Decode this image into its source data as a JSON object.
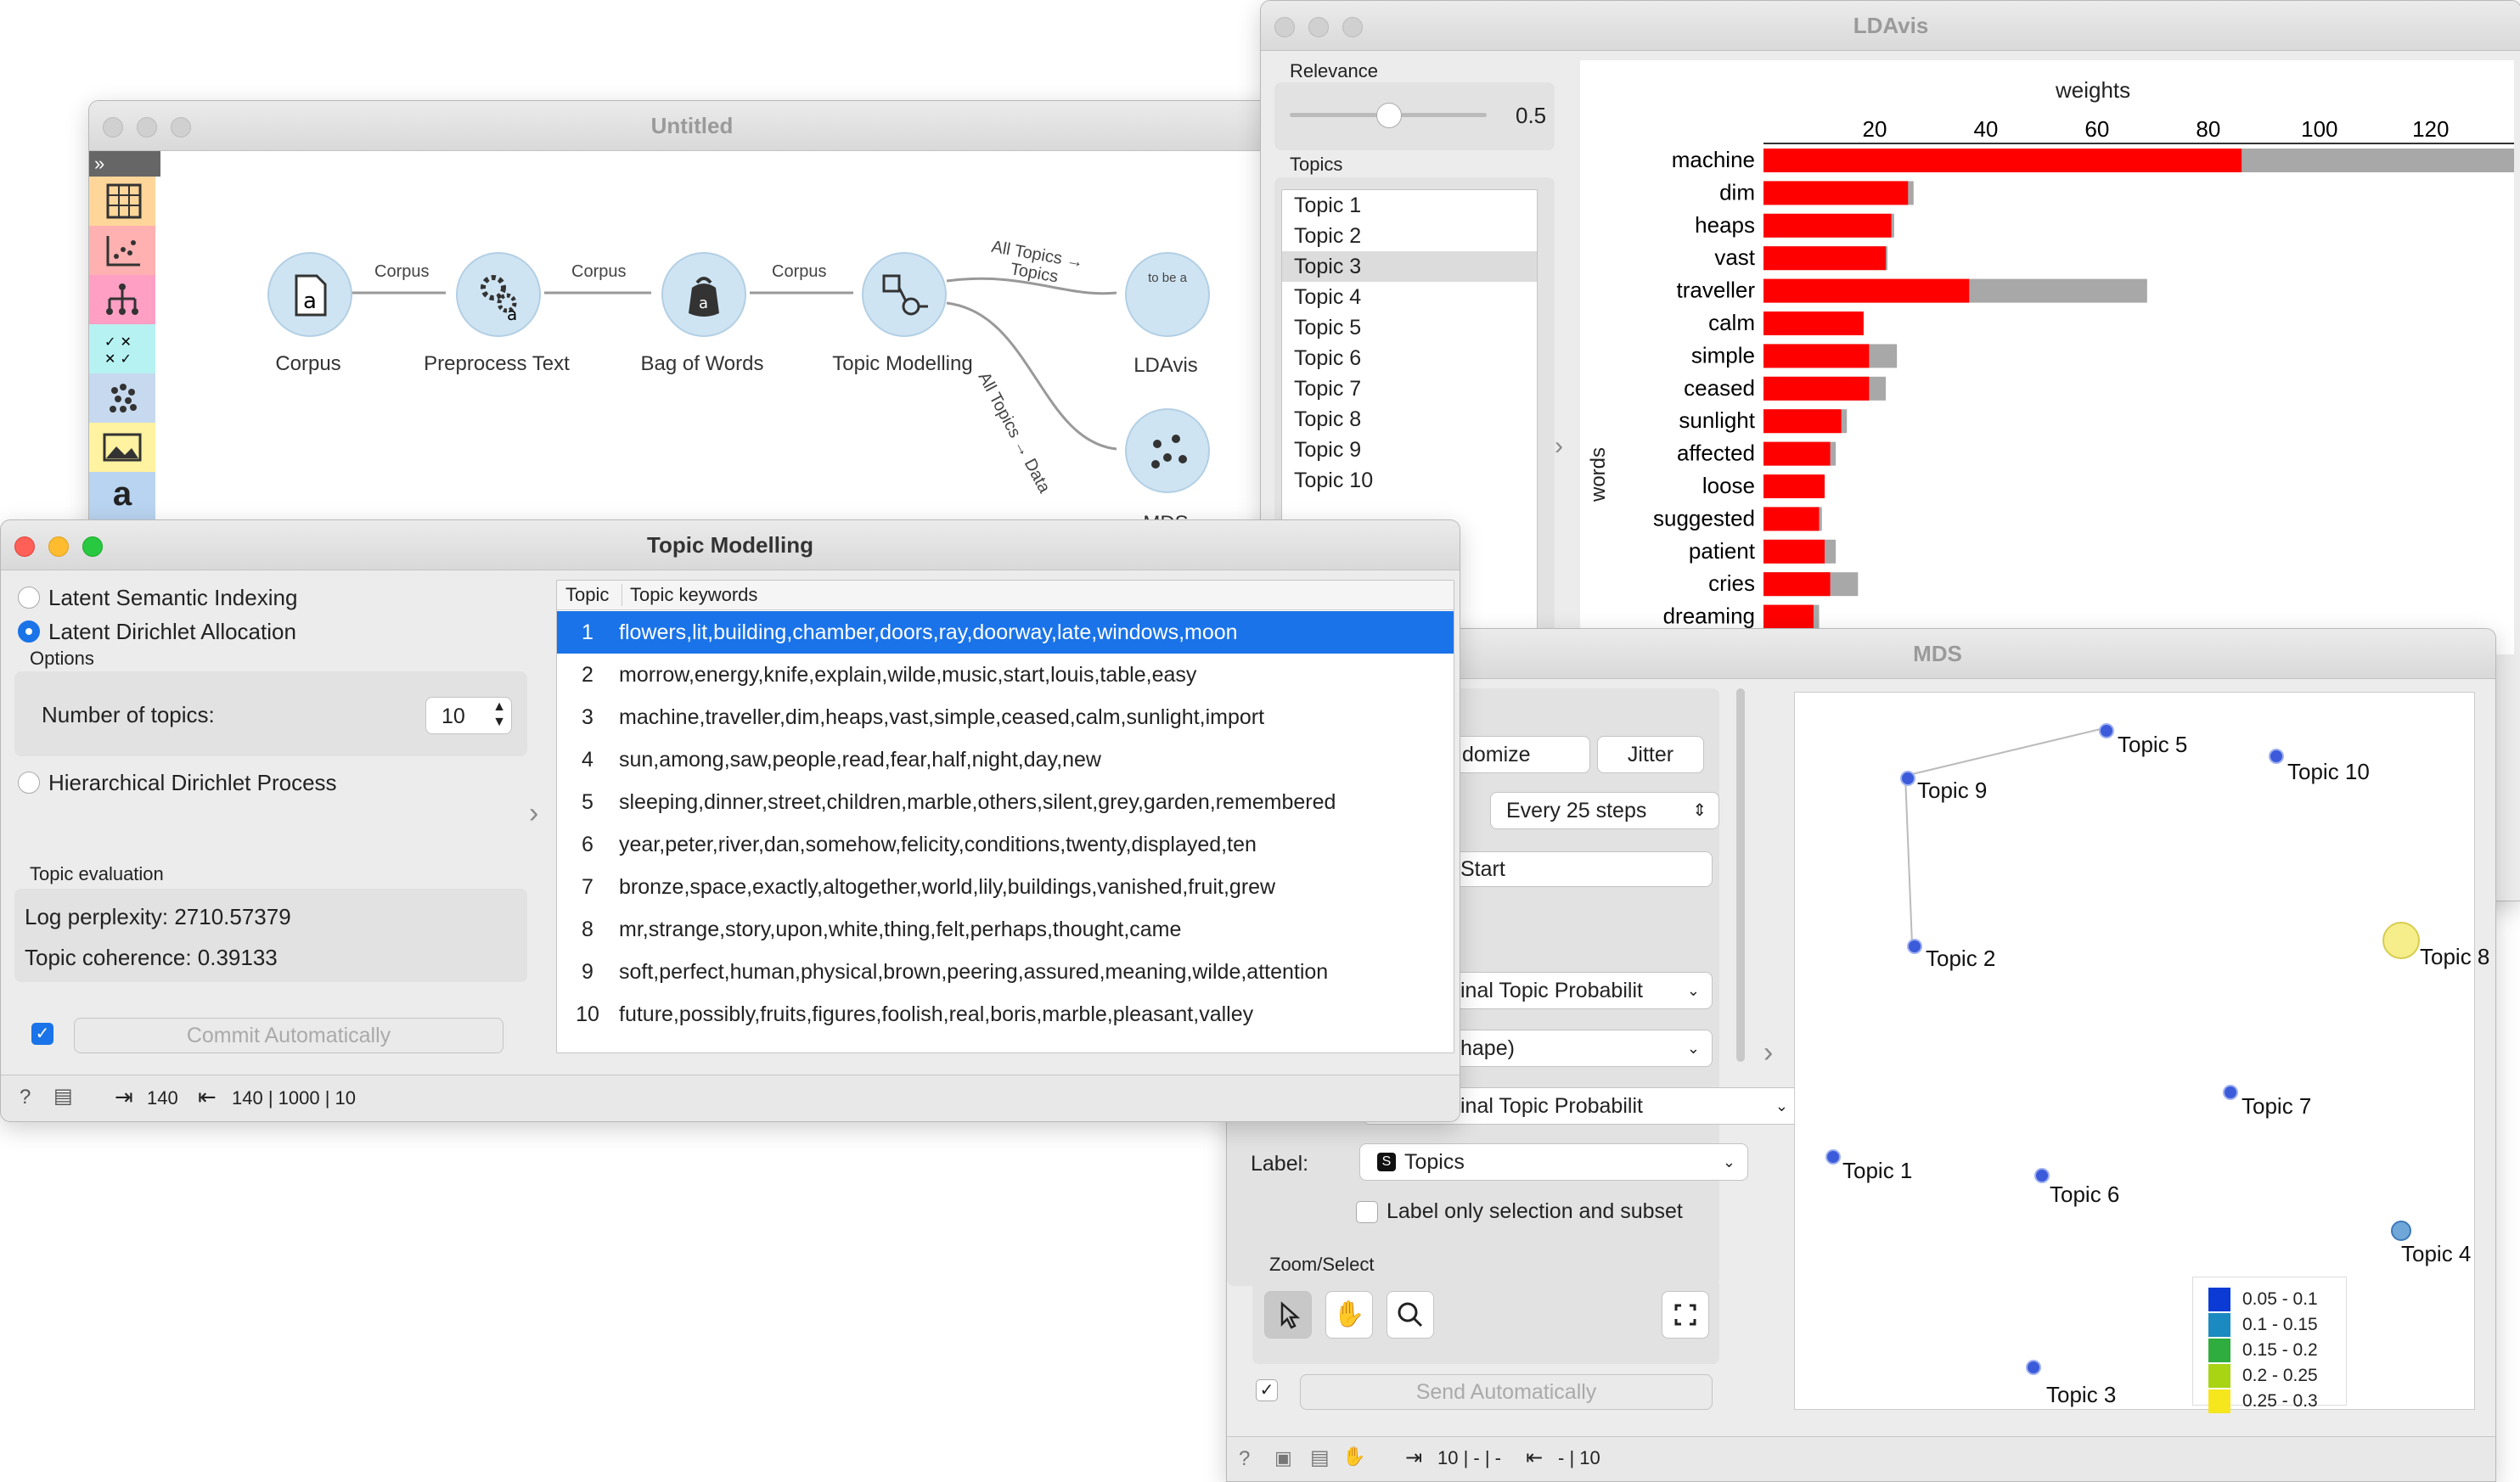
{
  "canvas_window": {
    "title": "Untitled",
    "nodes": [
      {
        "label": "Corpus"
      },
      {
        "label": "Preprocess Text"
      },
      {
        "label": "Bag of Words"
      },
      {
        "label": "Topic Modelling"
      },
      {
        "label": "LDAvis"
      },
      {
        "label": "MDS"
      }
    ],
    "links": [
      {
        "label": "Corpus"
      },
      {
        "label": "Corpus"
      },
      {
        "label": "Corpus"
      },
      {
        "label": "All Topics → Topics"
      },
      {
        "label": "All Topics → Data"
      }
    ],
    "ldavis_icon_text": "to be a",
    "toolbox_icons": [
      "data-table-icon",
      "scatter-icon",
      "tree-icon",
      "confusion-matrix-icon",
      "cluster-icon",
      "image-icon",
      "text-icon"
    ]
  },
  "topic_window": {
    "title": "Topic Modelling",
    "methods": [
      {
        "label": "Latent Semantic Indexing",
        "selected": false
      },
      {
        "label": "Latent Dirichlet Allocation",
        "selected": true
      },
      {
        "label": "Hierarchical Dirichlet Process",
        "selected": false
      }
    ],
    "options_label": "Options",
    "num_topics_label": "Number of topics:",
    "num_topics_value": "10",
    "evaluation_label": "Topic evaluation",
    "log_perplexity": "Log perplexity: 2710.57379",
    "coherence": "Topic coherence: 0.39133",
    "commit_label": "Commit Automatically",
    "table_headers": [
      "Topic",
      "Topic keywords"
    ],
    "rows": [
      {
        "num": "1",
        "keywords": "flowers,lit,building,chamber,doors,ray,doorway,late,windows,moon"
      },
      {
        "num": "2",
        "keywords": "morrow,energy,knife,explain,wilde,music,start,louis,table,easy"
      },
      {
        "num": "3",
        "keywords": "machine,traveller,dim,heaps,vast,simple,ceased,calm,sunlight,import"
      },
      {
        "num": "4",
        "keywords": "sun,among,saw,people,read,fear,half,night,day,new"
      },
      {
        "num": "5",
        "keywords": "sleeping,dinner,street,children,marble,others,silent,grey,garden,remembered"
      },
      {
        "num": "6",
        "keywords": "year,peter,river,dan,somehow,felicity,conditions,twenty,displayed,ten"
      },
      {
        "num": "7",
        "keywords": "bronze,space,exactly,altogether,world,lily,buildings,vanished,fruit,grew"
      },
      {
        "num": "8",
        "keywords": "mr,strange,story,upon,white,thing,felt,perhaps,thought,came"
      },
      {
        "num": "9",
        "keywords": "soft,perfect,human,physical,brown,peering,assured,meaning,wilde,attention"
      },
      {
        "num": "10",
        "keywords": "future,possibly,fruits,figures,foolish,real,boris,marble,pleasant,valley"
      }
    ],
    "status_in": "140",
    "status_out": "140 | 1000 | 10"
  },
  "ldavis_window": {
    "title": "LDAvis",
    "relevance_label": "Relevance",
    "relevance_value": "0.5",
    "relevance_fraction": 0.5,
    "topics_label": "Topics",
    "topics": [
      "Topic 1",
      "Topic 2",
      "Topic 3",
      "Topic 4",
      "Topic 5",
      "Topic 6",
      "Topic 7",
      "Topic 8",
      "Topic 9",
      "Topic 10"
    ],
    "selected_topic_index": 2
  },
  "chart_data": {
    "type": "bar",
    "title": "weights",
    "ylabel": "words",
    "xlim": [
      0,
      135
    ],
    "xticks": [
      "20",
      "40",
      "60",
      "80",
      "100",
      "120"
    ],
    "xtick_values": [
      20,
      40,
      60,
      80,
      100,
      120
    ],
    "categories": [
      "machine",
      "dim",
      "heaps",
      "vast",
      "traveller",
      "calm",
      "simple",
      "ceased",
      "sunlight",
      "affected",
      "loose",
      "suggested",
      "patient",
      "cries",
      "dreaming"
    ],
    "series": [
      {
        "color": "#ff0000",
        "values": [
          86,
          26,
          23,
          22,
          37,
          18,
          19,
          19,
          14,
          12,
          11,
          10,
          11,
          12,
          9
        ]
      },
      {
        "color": "#a8a8a8",
        "values": [
          135,
          27,
          23.5,
          22.3,
          69,
          18,
          24,
          22,
          15,
          13,
          11,
          10.5,
          13,
          17,
          10
        ]
      }
    ]
  },
  "mds_window": {
    "title": "MDS",
    "randomize_label": "domize",
    "jitter_label": "Jitter",
    "refresh_label": "Every 25 steps",
    "start_label": "Start",
    "color_select": "inal Topic Probabilit",
    "shape_select": "hape)",
    "size_select": "inal Topic Probabilit",
    "label_label": "Label:",
    "label_value": "Topics",
    "label_only_selection": "Label only selection and subset",
    "zoom_select_label": "Zoom/Select",
    "send_label": "Send Automatically",
    "status_in": "10 | - | -",
    "status_out": "- | 10",
    "points": [
      {
        "label": "Topic 1"
      },
      {
        "label": "Topic 2"
      },
      {
        "label": "Topic 3"
      },
      {
        "label": "Topic 4"
      },
      {
        "label": "Topic 5"
      },
      {
        "label": "Topic 6"
      },
      {
        "label": "Topic 7"
      },
      {
        "label": "Topic 8"
      },
      {
        "label": "Topic 9"
      },
      {
        "label": "Topic 10"
      }
    ],
    "legend": [
      {
        "label": "0.05 - 0.1",
        "color": "#0b3bd4"
      },
      {
        "label": "0.1 - 0.15",
        "color": "#1b8ac0"
      },
      {
        "label": "0.15 - 0.2",
        "color": "#2fad3e"
      },
      {
        "label": "0.2 - 0.25",
        "color": "#a8d414"
      },
      {
        "label": "0.25 - 0.3",
        "color": "#f5e61d"
      }
    ]
  }
}
